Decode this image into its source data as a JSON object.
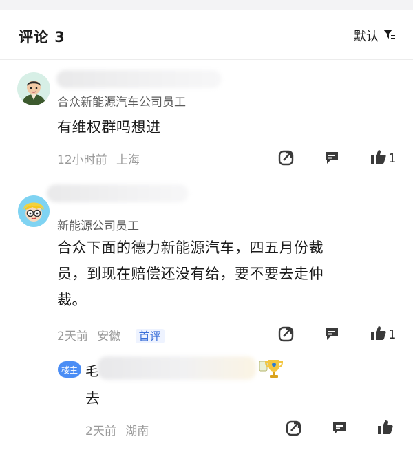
{
  "header": {
    "title": "评论 3",
    "sort_label": "默认"
  },
  "comments": [
    {
      "author": "",
      "tag": "合众新能源汽车公司员工",
      "content": "有维权群吗想进",
      "time": "12小时前",
      "location": "上海",
      "likes": "1"
    },
    {
      "author": "",
      "tag": "新能源公司员工",
      "content_lines": [
        "合众下面的德力新能源汽车，四五月份裁",
        "员，到现在赔偿还没有给，要不要去走仲",
        "裁。"
      ],
      "time": "2天前",
      "location": "安徽",
      "badge": "首评",
      "likes": "1"
    }
  ],
  "reply": {
    "owner_badge": "楼主",
    "author_prefix": "毛",
    "content": "去",
    "time": "2天前",
    "location": "湖南"
  },
  "icons": {
    "filter": "filter-icon",
    "share": "share-icon",
    "reply": "comment-icon",
    "like": "thumbs-up-icon",
    "trophy": "trophy-icon"
  },
  "colors": {
    "accent": "#4a8df5",
    "badge_text": "#3a6fd8",
    "meta": "#9a9a9a"
  }
}
